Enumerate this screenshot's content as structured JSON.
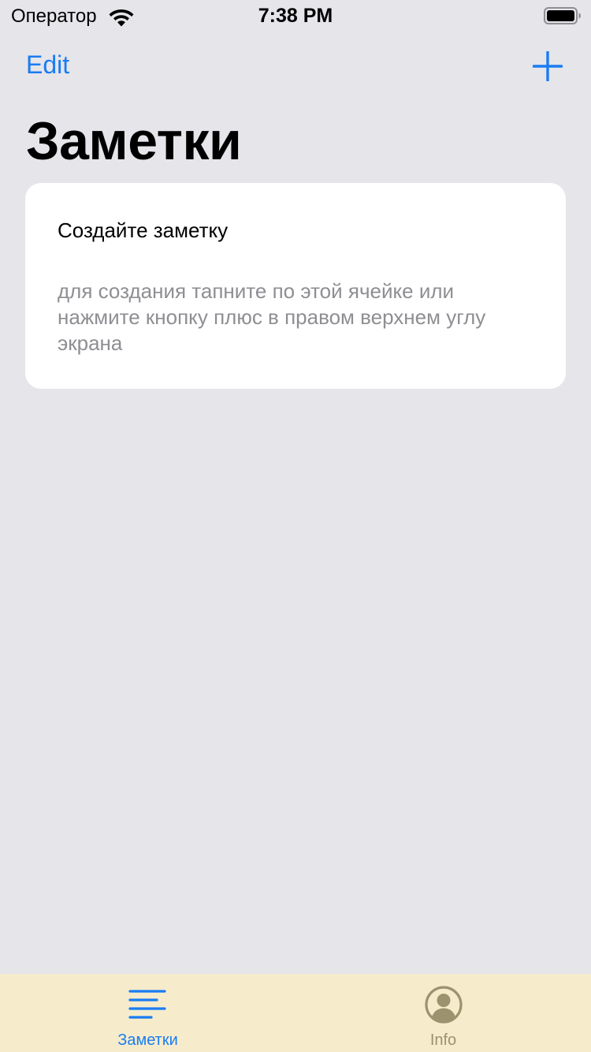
{
  "status_bar": {
    "carrier": "Оператор",
    "time": "7:38 PM"
  },
  "nav": {
    "edit_label": "Edit",
    "add_icon": "plus-icon",
    "title": "Заметки"
  },
  "note": {
    "title": "Создайте заметку",
    "body": "для создания тапните по этой ячейке или нажмите кнопку плюс в правом верхнем углу экрана"
  },
  "tab_bar": {
    "tabs": [
      {
        "label": "Заметки",
        "icon": "list-icon",
        "selected": true
      },
      {
        "label": "Info",
        "icon": "person-circle-icon",
        "selected": false
      }
    ]
  },
  "colors": {
    "accent": "#1a7cf2",
    "background": "#e5e5ea",
    "tab_bar_background": "#f6eccc",
    "tab_inactive": "#9c926d",
    "secondary_text": "#8e8e93"
  }
}
